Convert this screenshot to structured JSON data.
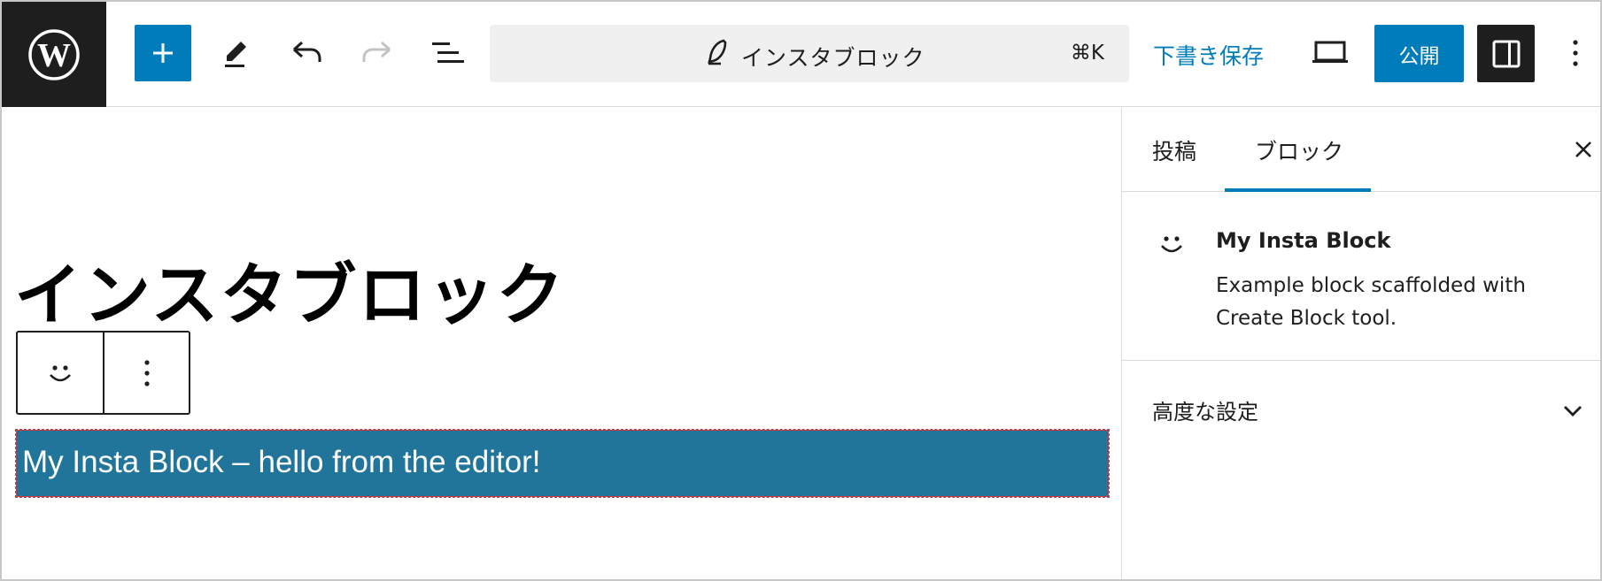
{
  "header": {
    "logo": "wordpress-logo",
    "inserter_icon": "plus-icon",
    "tools_icon": "pencil-icon",
    "undo_icon": "undo-icon",
    "redo_icon": "redo-icon",
    "document_overview_icon": "list-view-icon",
    "command_bar": {
      "icon": "feather-icon",
      "title": "インスタブロック",
      "shortcut": "⌘K"
    },
    "save_draft_label": "下書き保存",
    "preview_icon": "laptop-icon",
    "publish_label": "公開",
    "settings_icon": "sidebar-icon",
    "more_icon": "more-vertical-icon",
    "colors": {
      "accent": "#007cba",
      "dark": "#1e1e1e"
    }
  },
  "canvas": {
    "post_title": "インスタブロック",
    "block_toolbar": {
      "block_type_icon": "smiley-icon",
      "options_icon": "more-vertical-icon"
    },
    "block_text": "My Insta Block – hello from the editor!",
    "block_bg_color": "#21759b"
  },
  "sidebar": {
    "tabs": [
      {
        "label": "投稿",
        "active": false
      },
      {
        "label": "ブロック",
        "active": true
      }
    ],
    "close_icon": "close-icon",
    "block_card": {
      "icon": "smiley-icon",
      "title": "My Insta Block",
      "description": "Example block scaffolded with Create Block tool."
    },
    "advanced": {
      "label": "高度な設定",
      "icon": "chevron-down-icon"
    }
  }
}
